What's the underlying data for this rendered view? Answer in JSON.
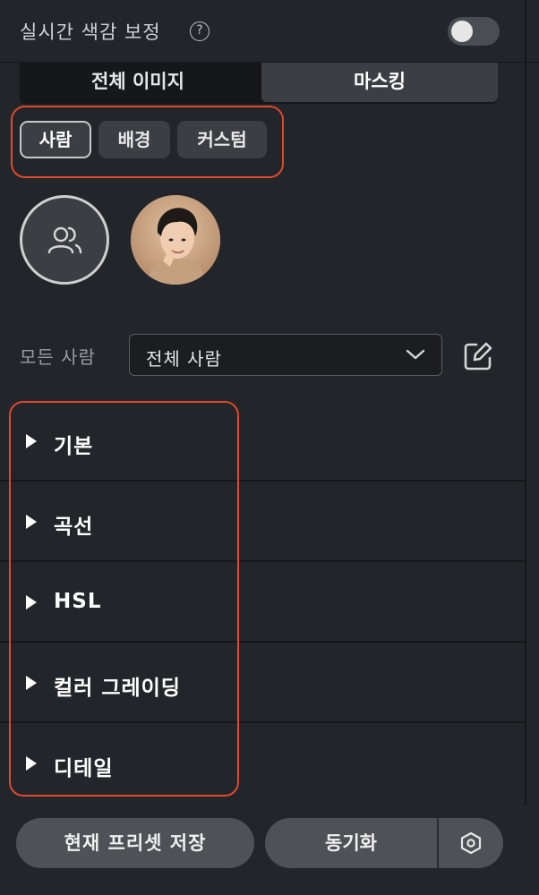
{
  "header": {
    "title": "실시간 색감 보정",
    "help_glyph": "?",
    "toggle_on": false
  },
  "scope_tabs": {
    "items": [
      {
        "label": "전체 이미지",
        "selected": false
      },
      {
        "label": "마스킹",
        "selected": true
      }
    ]
  },
  "segment_chips": {
    "items": [
      {
        "label": "사람",
        "selected": true
      },
      {
        "label": "배경",
        "selected": false
      },
      {
        "label": "커스텀",
        "selected": false
      }
    ]
  },
  "people": {
    "all_icon": "people-group-icon",
    "faces": [
      "person-face-thumbnail"
    ]
  },
  "filter": {
    "label": "모든 사람",
    "selected": "전체 사람",
    "edit_icon": "edit-icon"
  },
  "sections": [
    {
      "label": "기본"
    },
    {
      "label": "곡선"
    },
    {
      "label": "HSL"
    },
    {
      "label": "컬러 그레이딩"
    },
    {
      "label": "디테일"
    }
  ],
  "footer": {
    "save_label": "현재 프리셋 저장",
    "sync_label": "동기화",
    "settings_icon": "hexagon-settings-icon"
  },
  "colors": {
    "highlight_outline": "#e0492d",
    "panel_bg": "#222529",
    "control_bg": "#3b3e43"
  }
}
